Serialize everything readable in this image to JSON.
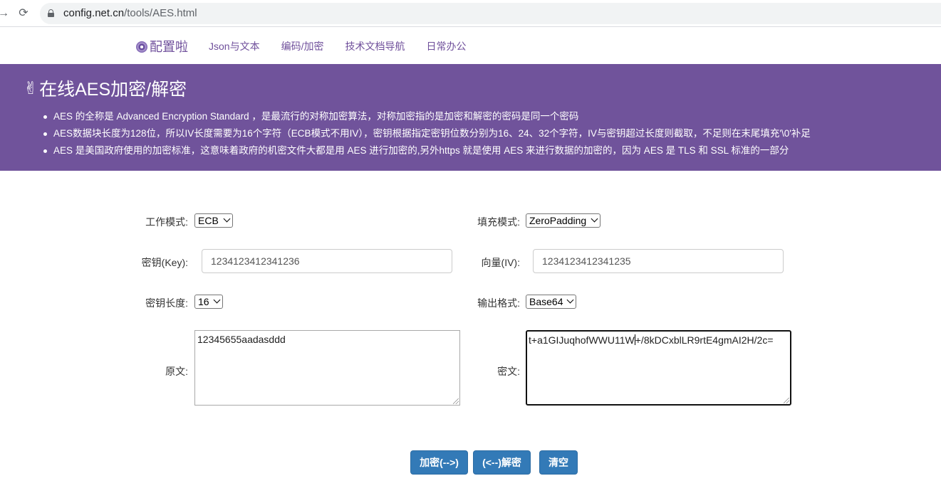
{
  "browser": {
    "url_host": "config.net.cn",
    "url_path": "/tools/AES.html"
  },
  "navbar": {
    "brand": "配置啦",
    "links": [
      "Json与文本",
      "编码/加密",
      "技术文档导航",
      "日常办公"
    ]
  },
  "hero": {
    "title": "在线AES加密/解密",
    "bullets": [
      "AES 的全称是 Advanced Encryption Standard ，是最流行的对称加密算法，对称加密指的是加密和解密的密码是同一个密码",
      "AES数据块长度为128位，所以IV长度需要为16个字符（ECB模式不用IV），密钥根据指定密钥位数分别为16、24、32个字符，IV与密钥超过长度则截取，不足则在末尾填充'\\0'补足",
      "AES 是美国政府使用的加密标准，这意味着政府的机密文件大都是用 AES 进行加密的,另外https 就是使用 AES 来进行数据的加密的，因为 AES 是 TLS 和 SSL 标准的一部分"
    ]
  },
  "form": {
    "mode_label": "工作模式:",
    "mode_value": "ECB",
    "padding_label": "填充模式:",
    "padding_value": "ZeroPadding",
    "key_label": "密钥(Key):",
    "key_value": "1234123412341236",
    "iv_label": "向量(IV):",
    "iv_value": "1234123412341235",
    "keylen_label": "密钥长度:",
    "keylen_value": "16",
    "output_label": "输出格式:",
    "output_value": "Base64",
    "plain_label": "原文:",
    "plain_value": "12345655aadasddd",
    "cipher_label": "密文:",
    "cipher_before_caret": "t+a1GIJuqhofWWU11W",
    "cipher_after_caret": "+/8kDCxblLR9rtE4gmAI2H/2c="
  },
  "buttons": {
    "encrypt": "加密(-->)",
    "decrypt": "(<--)解密",
    "clear": "清空"
  },
  "colors": {
    "brand_purple": "#70539b",
    "button_blue": "#337ab7"
  }
}
